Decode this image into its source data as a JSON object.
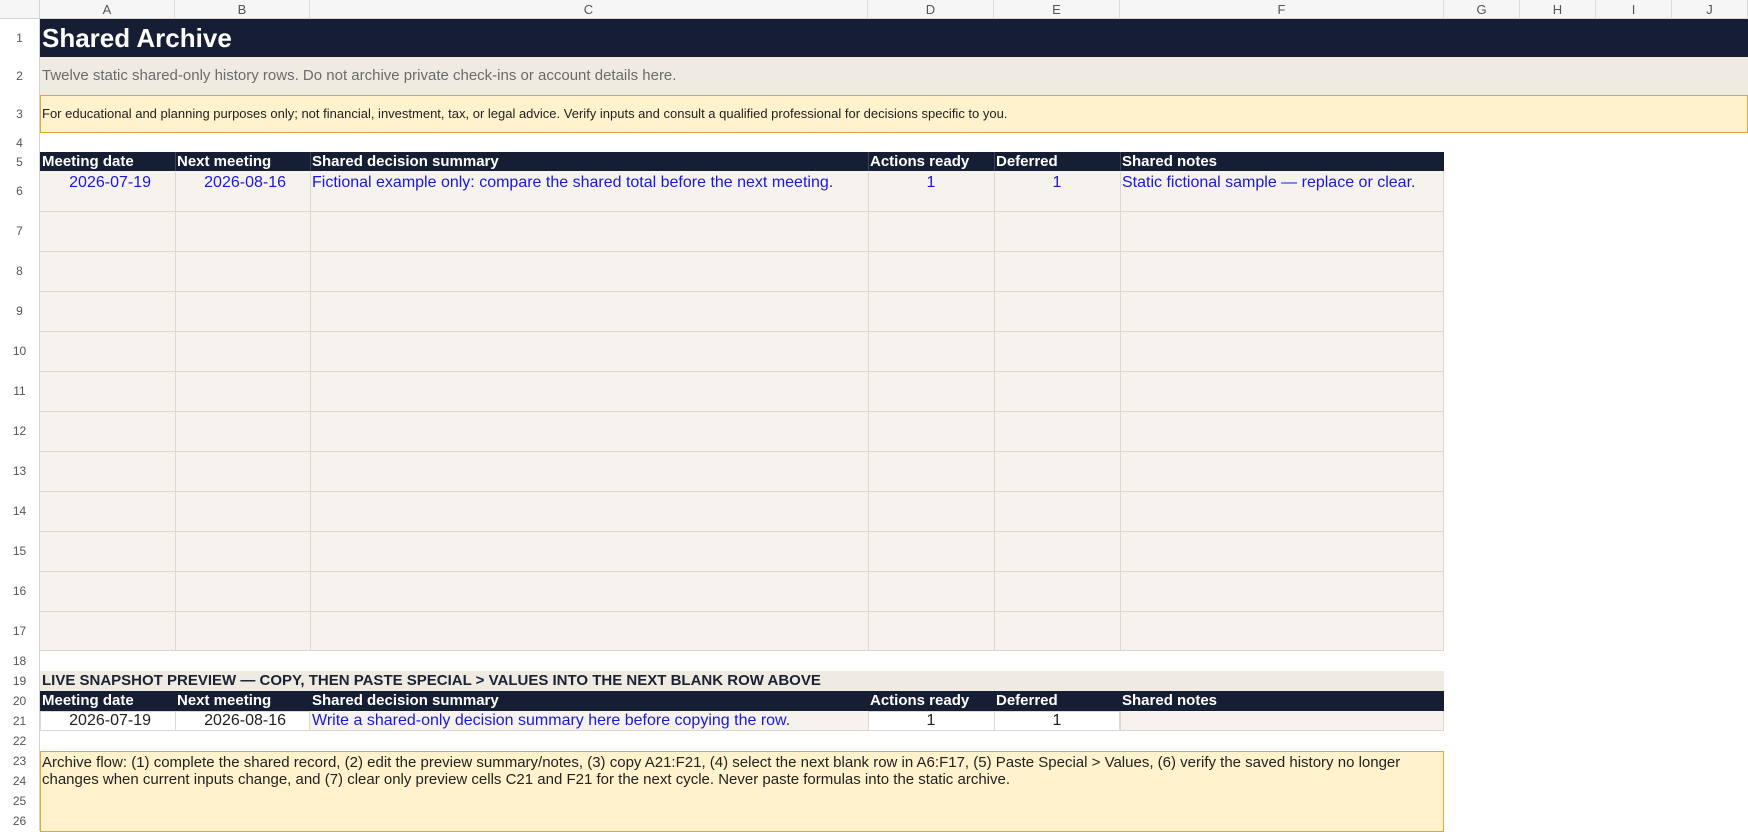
{
  "columns": [
    "A",
    "B",
    "C",
    "D",
    "E",
    "F",
    "G",
    "H",
    "I",
    "J"
  ],
  "rows": [
    "1",
    "2",
    "3",
    "4",
    "5",
    "6",
    "7",
    "8",
    "9",
    "10",
    "11",
    "12",
    "13",
    "14",
    "15",
    "16",
    "17",
    "18",
    "19",
    "20",
    "21",
    "22",
    "23",
    "24",
    "25",
    "26"
  ],
  "sheet": {
    "title": "Shared Archive",
    "subtitle": "Twelve static shared-only history rows. Do not archive private check-ins or account details here.",
    "disclaimer": "For educational and planning purposes only; not financial, investment, tax, or legal advice. Verify inputs and consult a qualified professional for decisions specific to you."
  },
  "archive": {
    "headers": [
      "Meeting date",
      "Next meeting",
      "Shared decision summary",
      "Actions ready",
      "Deferred",
      "Shared notes"
    ],
    "row6": {
      "meeting_date": "2026-07-19",
      "next_meeting": "2026-08-16",
      "summary": "Fictional example only: compare the shared total before the next meeting.",
      "actions_ready": "1",
      "deferred": "1",
      "notes": "Static fictional sample — replace or clear."
    }
  },
  "preview": {
    "title": "LIVE SNAPSHOT PREVIEW — COPY, THEN PASTE SPECIAL > VALUES INTO THE NEXT BLANK ROW ABOVE",
    "headers": [
      "Meeting date",
      "Next meeting",
      "Shared decision summary",
      "Actions ready",
      "Deferred",
      "Shared notes"
    ],
    "row21": {
      "meeting_date": "2026-07-19",
      "next_meeting": "2026-08-16",
      "summary": "Write a shared-only decision summary here before copying the row.",
      "actions_ready": "1",
      "deferred": "1",
      "notes": ""
    }
  },
  "archive_flow": "Archive flow: (1) complete the shared record, (2) edit the preview summary/notes, (3) copy A21:F21, (4) select the next blank row in A6:F17, (5) Paste Special > Values, (6) verify the saved history no longer changes when current inputs change, and (7) clear only preview cells C21 and F21 for the next cycle. Never paste formulas into the static archive.",
  "colors": {
    "navy": "#161e33",
    "beige": "#f0ebe2",
    "paper": "#f6f3ee",
    "warning_fill": "#fff2cc",
    "warning_border": "#e2a72e",
    "input_blue": "#1a18d8"
  }
}
